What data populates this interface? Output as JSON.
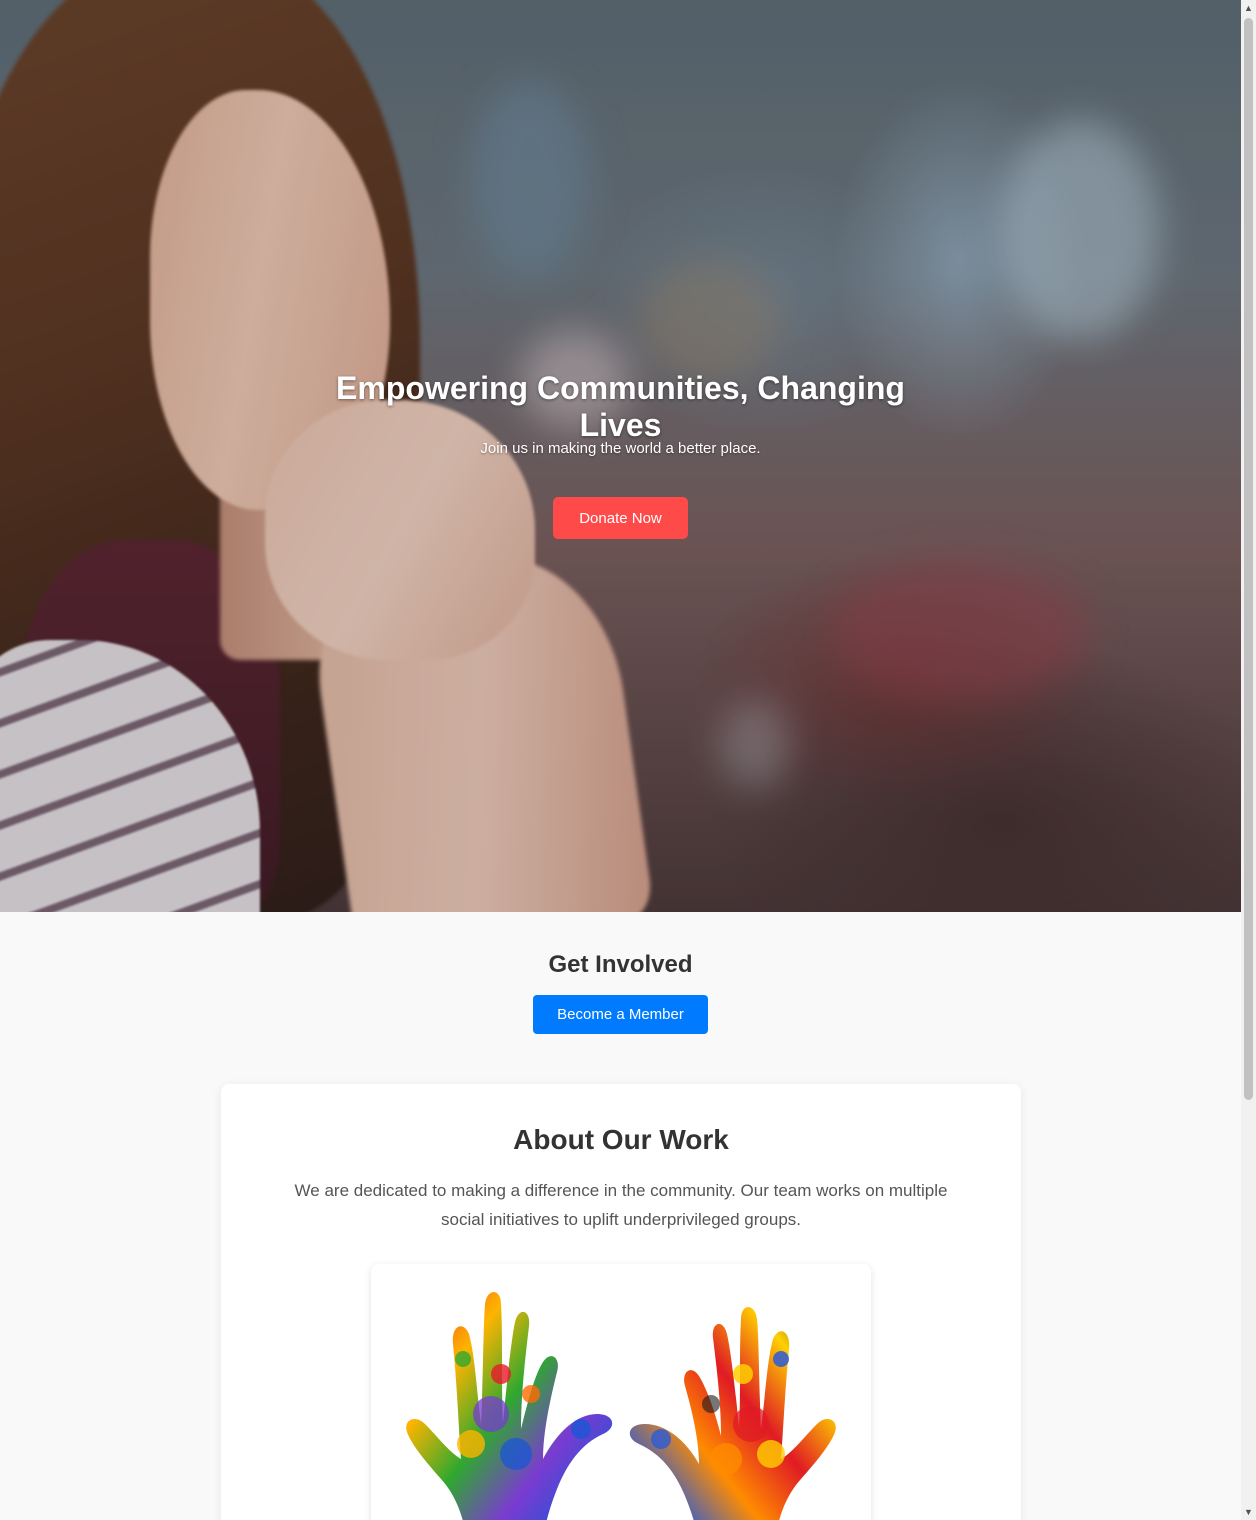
{
  "hero": {
    "title": "Empowering Communities, Changing Lives",
    "subtitle": "Join us in making the world a better place.",
    "donate_label": "Donate Now"
  },
  "involved": {
    "title": "Get Involved",
    "member_label": "Become a Member"
  },
  "about": {
    "title": "About Our Work",
    "text": "We are dedicated to making a difference in the community. Our team works on multiple social initiatives to uplift underprivileged groups."
  },
  "colors": {
    "donate": "#ff4a4a",
    "member": "#007bff",
    "page_bg": "#f9f9f9"
  },
  "icons": {
    "scroll_up": "▲",
    "scroll_down": "▼"
  }
}
